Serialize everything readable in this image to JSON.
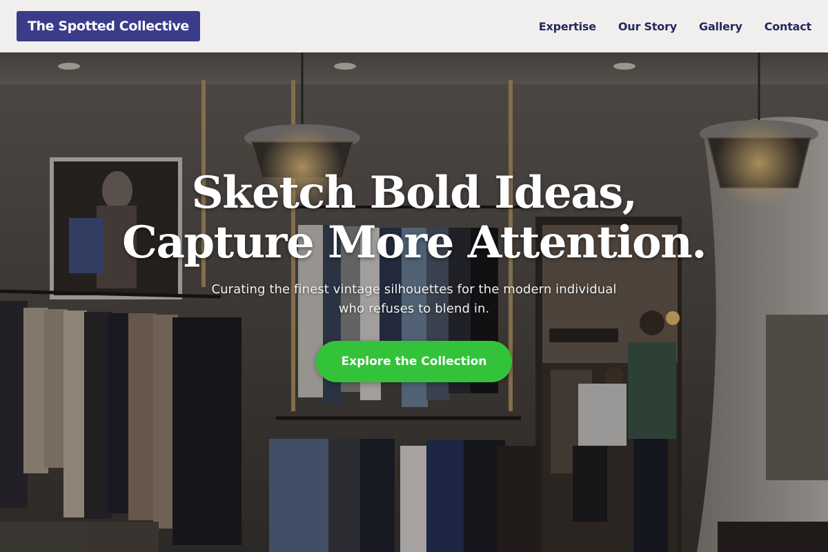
{
  "header": {
    "logo_text": "The Spotted Collective",
    "nav": [
      {
        "label": "Expertise"
      },
      {
        "label": "Our Story"
      },
      {
        "label": "Gallery"
      },
      {
        "label": "Contact"
      }
    ]
  },
  "hero": {
    "headline_line1": "Sketch Bold Ideas,",
    "headline_line2": "Capture More Attention.",
    "subtitle_line1": "Curating the finest vintage silhouettes for the modern individual",
    "subtitle_line2": "who refuses to blend in.",
    "cta_label": "Explore the Collection",
    "background_image": "clothing-store-interior"
  },
  "colors": {
    "logo_bg": "#3a3c8a",
    "nav_text": "#25285c",
    "header_bg": "#f0efee",
    "cta_bg": "#33c33a"
  }
}
